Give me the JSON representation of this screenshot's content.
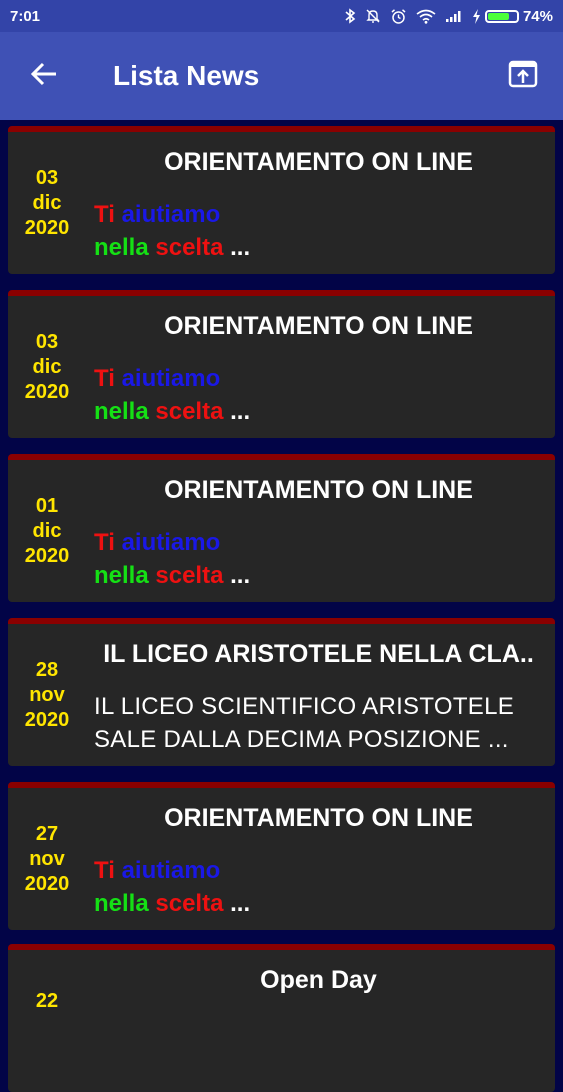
{
  "status_bar": {
    "time": "7:01",
    "battery_percent": "74%",
    "battery_level": 0.74,
    "icons": [
      "bluetooth-icon",
      "mute-icon",
      "alarm-icon",
      "wifi-icon",
      "signal-icon",
      "charging-icon",
      "battery-icon"
    ]
  },
  "app_bar": {
    "title": "Lista News",
    "back_icon": "arrow-left-icon",
    "share_icon": "share-icon"
  },
  "colors": {
    "app_bar": "#3f51b5",
    "background": "#020447",
    "card": "#262626",
    "card_accent": "#8a0000",
    "date_text": "#ffe500"
  },
  "news": [
    {
      "day": "03",
      "month": "dic",
      "year": "2020",
      "title": "ORIENTAMENTO ON LINE",
      "w1": "Ti",
      "w2": "aiutiamo",
      "w3": "nella",
      "w4": "scelta",
      "ellipsis": "..."
    },
    {
      "day": "03",
      "month": "dic",
      "year": "2020",
      "title": "ORIENTAMENTO ON LINE",
      "w1": "Ti",
      "w2": "aiutiamo",
      "w3": "nella",
      "w4": "scelta",
      "ellipsis": "..."
    },
    {
      "day": "01",
      "month": "dic",
      "year": "2020",
      "title": "ORIENTAMENTO ON LINE",
      "w1": "Ti",
      "w2": "aiutiamo",
      "w3": "nella",
      "w4": "scelta",
      "ellipsis": "..."
    },
    {
      "day": "28",
      "month": "nov",
      "year": "2020",
      "title": "IL LICEO ARISTOTELE NELLA CLA..",
      "line1": "IL LICEO SCIENTIFICO ARISTOTELE",
      "line2": "SALE DALLA DECIMA POSIZIONE ..."
    },
    {
      "day": "27",
      "month": "nov",
      "year": "2020",
      "title": "ORIENTAMENTO ON LINE",
      "w1": "Ti",
      "w2": "aiutiamo",
      "w3": "nella",
      "w4": "scelta",
      "ellipsis": "..."
    },
    {
      "day": "22",
      "month": "",
      "year": "",
      "title": "Open Day"
    }
  ]
}
